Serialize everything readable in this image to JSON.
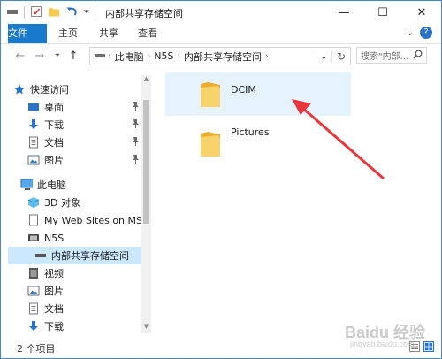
{
  "window": {
    "title": "内部共享存储空间",
    "minimize_glyph": "—",
    "maximize_glyph": "☐",
    "close_glyph": "✕"
  },
  "ribbon": {
    "tabs": [
      "文件",
      "主页",
      "共享",
      "查看"
    ],
    "collapse_glyph": "⌄",
    "help_glyph": "?"
  },
  "address": {
    "crumbs": [
      "此电脑",
      "N5S",
      "内部共享存储空间"
    ],
    "sep": "›",
    "refresh_glyph": "↻",
    "dropdown_glyph": "⌄",
    "search_placeholder": "搜索\"内部...",
    "search_glyph": "⚲"
  },
  "nav": {
    "pin_glyph": "📌",
    "items": [
      {
        "label": "快速访问",
        "icon": "star-icon"
      },
      {
        "label": "桌面",
        "icon": "desktop-icon"
      },
      {
        "label": "下载",
        "icon": "download-icon"
      },
      {
        "label": "文档",
        "icon": "document-icon"
      },
      {
        "label": "图片",
        "icon": "picture-icon"
      },
      {
        "label": "此电脑",
        "icon": "computer-icon"
      },
      {
        "label": "3D 对象",
        "icon": "cube-icon"
      },
      {
        "label": "My Web Sites on MSN",
        "icon": "page-icon"
      },
      {
        "label": "N5S",
        "icon": "phone-icon"
      },
      {
        "label": "内部共享存储空间",
        "icon": "storage-icon"
      },
      {
        "label": "视频",
        "icon": "video-icon"
      },
      {
        "label": "图片",
        "icon": "picture-icon"
      },
      {
        "label": "文档",
        "icon": "document-icon"
      },
      {
        "label": "下载",
        "icon": "download-icon"
      }
    ]
  },
  "content": {
    "files": [
      {
        "name": "DCIM",
        "icon": "folder-icon"
      },
      {
        "name": "Pictures",
        "icon": "folder-icon"
      }
    ]
  },
  "status": {
    "count": "2 个项目"
  },
  "watermark": {
    "brand": "Baidu 经验",
    "url": "jingyan.baidu.com"
  },
  "colors": {
    "accent": "#1979ca",
    "selection": "#cce8ff",
    "hover": "#e5f3ff",
    "folder": "#f6c94f",
    "arrow": "#e8363b"
  }
}
